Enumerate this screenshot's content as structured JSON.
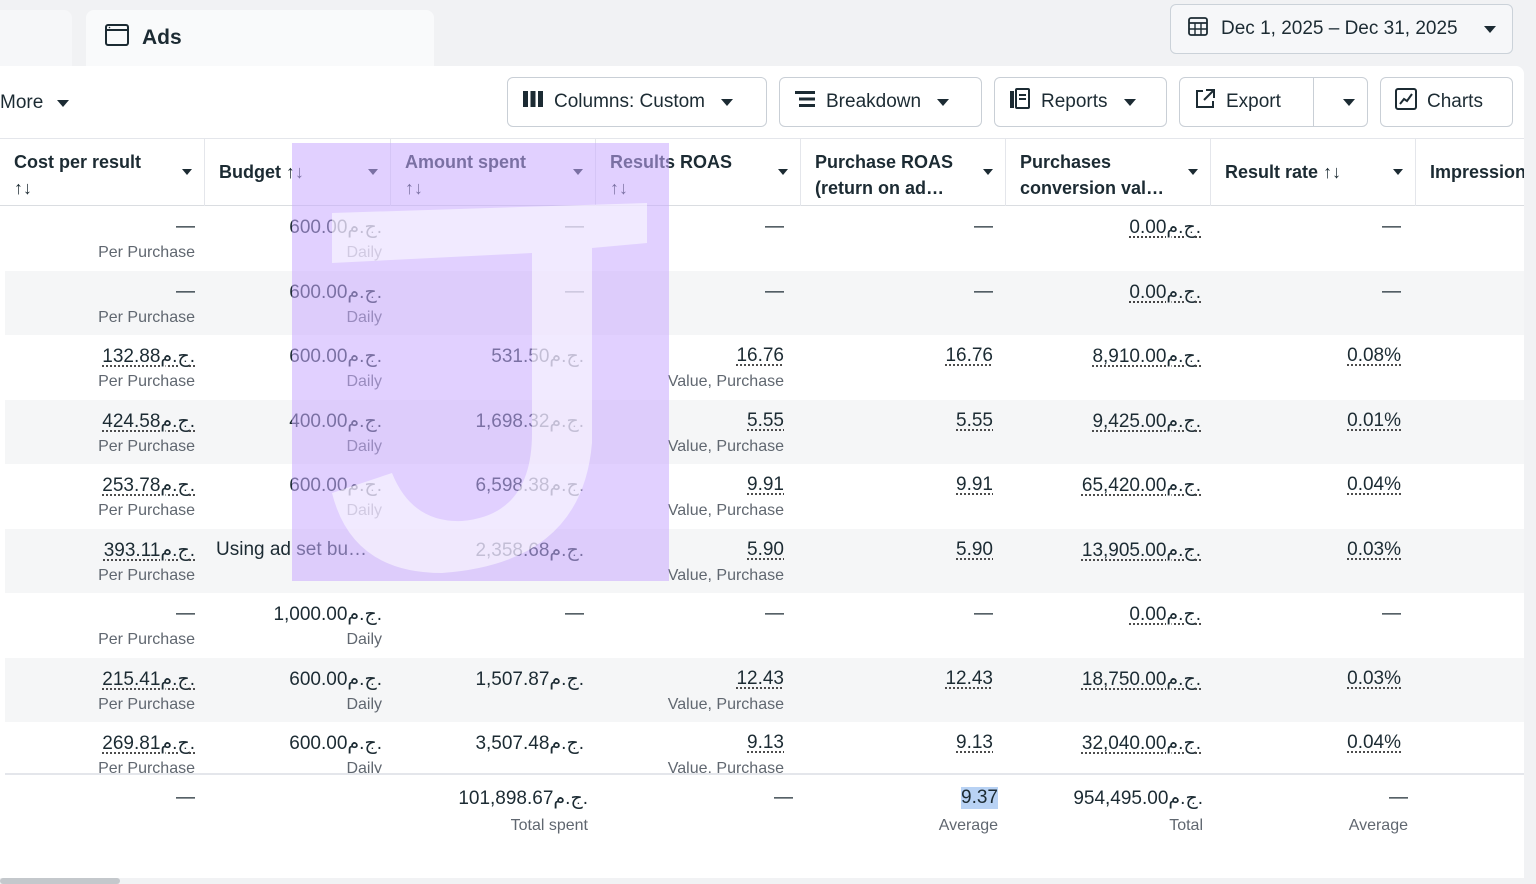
{
  "header": {
    "tab_label": "Ads",
    "tab_icon": "window-icon",
    "date_range": "Dec 1, 2025 – Dec 31, 2025"
  },
  "toolbar": {
    "more": "More",
    "columns": "Columns: Custom",
    "breakdown": "Breakdown",
    "reports": "Reports",
    "export": "Export",
    "charts": "Charts"
  },
  "columns": {
    "cost_per_result": "Cost per result",
    "budget": "Budget",
    "amount_spent": "Amount spent",
    "results_roas": "Results ROAS",
    "purchase_roas": "Purchase ROAS (return on ad…",
    "purchases_conv_value": "Purchases conversion val…",
    "result_rate": "Result rate",
    "impressions": "Impression",
    "sort_glyph": "↑↓"
  },
  "rows": [
    {
      "cpr": "—",
      "cpr_sub": "Per Purchase",
      "budget": "600.00ج.م.",
      "budget_sub": "Daily",
      "spent": "—",
      "rroas": "—",
      "rroas_sub": "",
      "proas": "—",
      "pcv": "0.00ج.م.",
      "rate": "—"
    },
    {
      "cpr": "—",
      "cpr_sub": "Per Purchase",
      "budget": "600.00ج.م.",
      "budget_sub": "Daily",
      "spent": "—",
      "rroas": "—",
      "rroas_sub": "",
      "proas": "—",
      "pcv": "0.00ج.م.",
      "rate": "—"
    },
    {
      "cpr": "132.88ج.م.",
      "cpr_sub": "Per Purchase",
      "budget": "600.00ج.م.",
      "budget_sub": "Daily",
      "spent": "531.50ج.م.",
      "rroas": "16.76",
      "rroas_sub": "Value, Purchase",
      "proas": "16.76",
      "pcv": "8,910.00ج.م.",
      "rate": "0.08%"
    },
    {
      "cpr": "424.58ج.م.",
      "cpr_sub": "Per Purchase",
      "budget": "400.00ج.م.",
      "budget_sub": "Daily",
      "spent": "1,698.32ج.م.",
      "rroas": "5.55",
      "rroas_sub": "Value, Purchase",
      "proas": "5.55",
      "pcv": "9,425.00ج.م.",
      "rate": "0.01%"
    },
    {
      "cpr": "253.78ج.م.",
      "cpr_sub": "Per Purchase",
      "budget": "600.00ج.م.",
      "budget_sub": "Daily",
      "spent": "6,598.38ج.م.",
      "rroas": "9.91",
      "rroas_sub": "Value, Purchase",
      "proas": "9.91",
      "pcv": "65,420.00ج.م.",
      "rate": "0.04%"
    },
    {
      "cpr": "393.11ج.م.",
      "cpr_sub": "Per Purchase",
      "budget": "Using ad set bu…",
      "budget_sub": "",
      "spent": "2,358.68ج.م.",
      "rroas": "5.90",
      "rroas_sub": "Value, Purchase",
      "proas": "5.90",
      "pcv": "13,905.00ج.م.",
      "rate": "0.03%"
    },
    {
      "cpr": "—",
      "cpr_sub": "Per Purchase",
      "budget": "1,000.00ج.م.",
      "budget_sub": "Daily",
      "spent": "—",
      "rroas": "—",
      "rroas_sub": "",
      "proas": "—",
      "pcv": "0.00ج.م.",
      "rate": "—"
    },
    {
      "cpr": "215.41ج.م.",
      "cpr_sub": "Per Purchase",
      "budget": "600.00ج.م.",
      "budget_sub": "Daily",
      "spent": "1,507.87ج.م.",
      "rroas": "12.43",
      "rroas_sub": "Value, Purchase",
      "proas": "12.43",
      "pcv": "18,750.00ج.م.",
      "rate": "0.03%"
    },
    {
      "cpr": "269.81ج.م.",
      "cpr_sub": "Per Purchase",
      "budget": "600.00ج.م.",
      "budget_sub": "Daily",
      "spent": "3,507.48ج.م.",
      "rroas": "9.13",
      "rroas_sub": "Value, Purchase",
      "proas": "9.13",
      "pcv": "32,040.00ج.م.",
      "rate": "0.04%"
    }
  ],
  "summary": {
    "cpr": "—",
    "spent": "101,898.67ج.م.",
    "spent_sub": "Total spent",
    "rroas": "—",
    "proas": "9.37",
    "proas_sub": "Average",
    "pcv": "954,495.00ج.م.",
    "pcv_sub": "Total",
    "rate": "—",
    "rate_sub": "Average"
  }
}
